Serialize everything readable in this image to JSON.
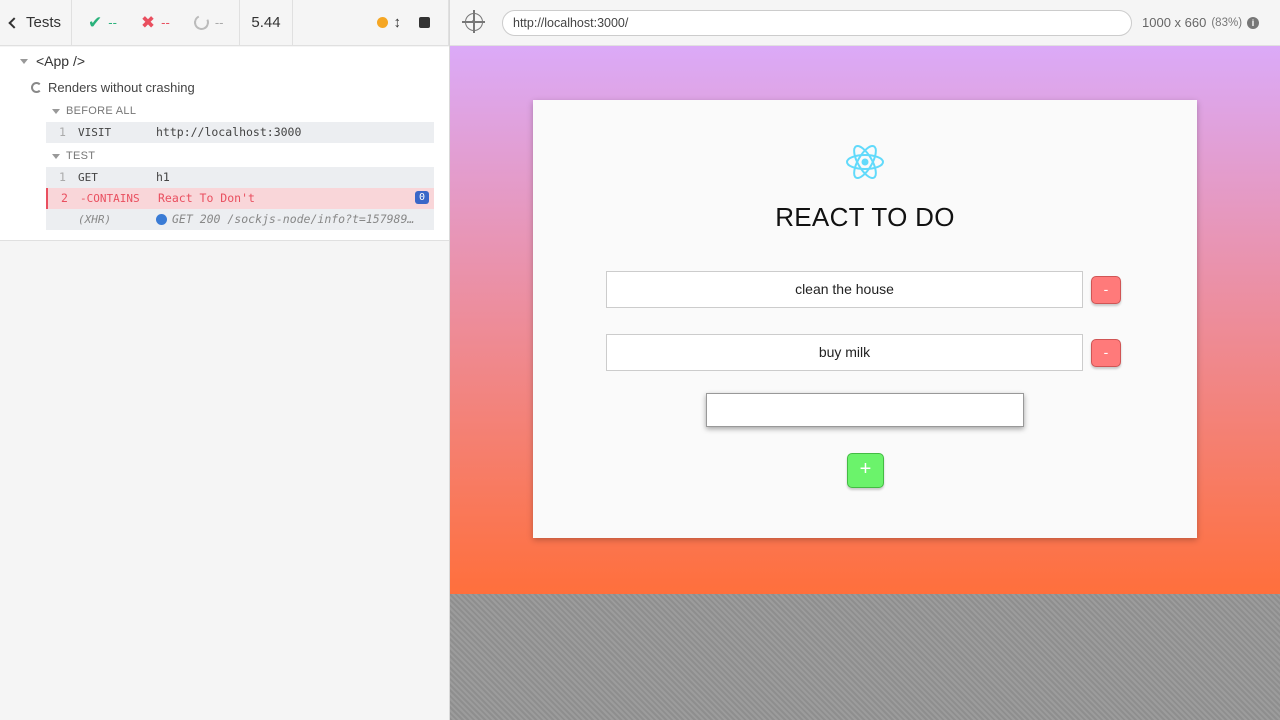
{
  "reporter": {
    "header": {
      "tests_label": "Tests",
      "passed_count": "--",
      "failed_count": "--",
      "pending_count": "--",
      "duration": "5.44"
    },
    "suite": {
      "title": "<App />",
      "test": {
        "title": "Renders without crashing",
        "hooks": [
          {
            "title": "BEFORE ALL",
            "commands": [
              {
                "number": "1",
                "name": "VISIT",
                "message": "http://localhost:3000"
              }
            ]
          },
          {
            "title": "TEST",
            "commands": [
              {
                "number": "1",
                "name": "GET",
                "message": "h1"
              },
              {
                "number": "2",
                "name": "-CONTAINS",
                "message": "React To Don't",
                "badge": "0",
                "state": "failed"
              },
              {
                "number": "",
                "name": "(XHR)",
                "message": "GET 200 /sockjs-node/info?t=157989…"
              }
            ]
          }
        ]
      }
    }
  },
  "aut": {
    "url": "http://localhost:3000/",
    "viewport": "1000 x 660",
    "scale": "(83%)",
    "app": {
      "title": "REACT TO DO",
      "todos": [
        "clean the house",
        "buy milk"
      ],
      "remove_label": "-",
      "add_label": "+",
      "new_todo_value": ""
    },
    "colors": {
      "gradient_top": "#dbaaf8",
      "gradient_bottom": "#ff6f3c",
      "remove_button": "#ff7a7a",
      "add_button": "#6bf36b",
      "react_logo": "#61dafb"
    }
  }
}
